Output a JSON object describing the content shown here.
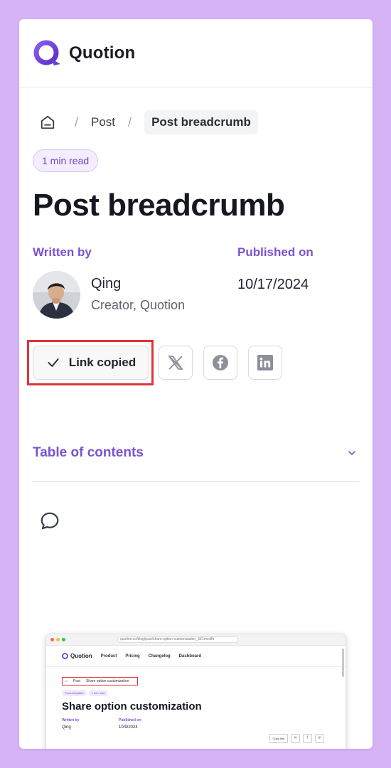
{
  "header": {
    "brand": "Quotion"
  },
  "breadcrumb": {
    "home_icon": "home-icon",
    "separator": "/",
    "post": "Post",
    "current": "Post breadcrumb"
  },
  "article": {
    "read_time": "1 min read",
    "title": "Post breadcrumb",
    "written_by_label": "Written by",
    "published_on_label": "Published on",
    "author_name": "Qing",
    "author_role": "Creator, Quotion",
    "published_date": "10/17/2024"
  },
  "share": {
    "copy_label": "Link copied",
    "icons": [
      "x-icon",
      "facebook-icon",
      "linkedin-icon"
    ]
  },
  "toc": {
    "label": "Table of contents"
  },
  "embedded_screenshot": {
    "url": "quotion.co/blog/post/share-option-customization_3Z1mvx8h",
    "brand": "Quotion",
    "nav": [
      "Product",
      "Pricing",
      "Changelog",
      "Dashboard"
    ],
    "breadcrumb": [
      "Post",
      "Share option customization"
    ],
    "badges": [
      "ProductUpdate",
      "1 min read"
    ],
    "title": "Share option customization",
    "written_by": "Written by",
    "published_on": "Published on",
    "author": "Qing",
    "date": "10/9/2024",
    "copy_link": "Copy link"
  },
  "colors": {
    "accent": "#7b52d1",
    "background": "#d5b3f5",
    "highlight": "#e1323a"
  }
}
